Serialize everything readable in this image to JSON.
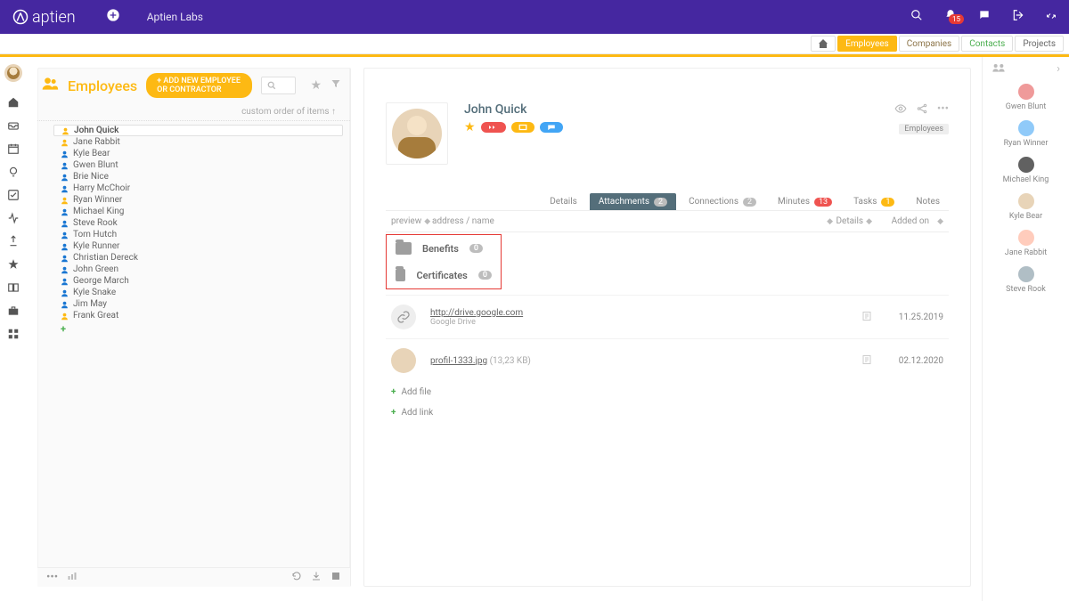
{
  "header": {
    "brand": "aptien",
    "company": "Aptien Labs",
    "notificationCount": "15"
  },
  "nav": {
    "home": "",
    "employees": "Employees",
    "companies": "Companies",
    "contacts": "Contacts",
    "projects": "Projects"
  },
  "leftPanel": {
    "title": "Employees",
    "addBtn": "+ ADD NEW EMPLOYEE OR CONTRACTOR",
    "sortLabel": "custom order of items",
    "employees": [
      {
        "name": "John Quick",
        "color": "y",
        "selected": true
      },
      {
        "name": "Jane Rabbit",
        "color": "y"
      },
      {
        "name": "Kyle Bear",
        "color": "b"
      },
      {
        "name": "Gwen Blunt",
        "color": "b"
      },
      {
        "name": "Brie Nice",
        "color": "b"
      },
      {
        "name": "Harry McChoir",
        "color": "b"
      },
      {
        "name": "Ryan Winner",
        "color": "y"
      },
      {
        "name": "Michael King",
        "color": "b"
      },
      {
        "name": "Steve Rook",
        "color": "b"
      },
      {
        "name": "Tom Hutch",
        "color": "b"
      },
      {
        "name": "Kyle Runner",
        "color": "b"
      },
      {
        "name": "Christian Dereck",
        "color": "b"
      },
      {
        "name": "John Green",
        "color": "b"
      },
      {
        "name": "George March",
        "color": "b"
      },
      {
        "name": "Kyle Snake",
        "color": "b"
      },
      {
        "name": "Jim May",
        "color": "b"
      },
      {
        "name": "Frank Great",
        "color": "y"
      }
    ]
  },
  "detail": {
    "name": "John Quick",
    "badge": "Employees",
    "tabs": {
      "details": "Details",
      "attachments": "Attachments",
      "attachmentsCount": "2",
      "connections": "Connections",
      "connectionsCount": "2",
      "minutes": "Minutes",
      "minutesCount": "13",
      "tasks": "Tasks",
      "tasksCount": "1",
      "notes": "Notes"
    },
    "columns": {
      "preview": "preview",
      "address": "address / name",
      "details": "Details",
      "added": "Added on"
    },
    "folders": [
      {
        "name": "Benefits",
        "count": "0"
      },
      {
        "name": "Certificates",
        "count": "0"
      }
    ],
    "attachments": [
      {
        "line1": "http://drive.google.com",
        "line2": "Google Drive",
        "date": "11.25.2019",
        "type": "link"
      },
      {
        "line1": "profil-1333.jpg",
        "line2": "(13,23 KB)",
        "date": "02.12.2020",
        "type": "image"
      }
    ],
    "addFile": "Add file",
    "addLink": "Add link"
  },
  "rightRail": {
    "people": [
      {
        "name": "Gwen Blunt",
        "c": "c1"
      },
      {
        "name": "Ryan Winner",
        "c": "c2"
      },
      {
        "name": "Michael King",
        "c": "c3"
      },
      {
        "name": "Kyle Bear",
        "c": "c4"
      },
      {
        "name": "Jane Rabbit",
        "c": "c5"
      },
      {
        "name": "Steve Rook",
        "c": "c6"
      }
    ]
  }
}
